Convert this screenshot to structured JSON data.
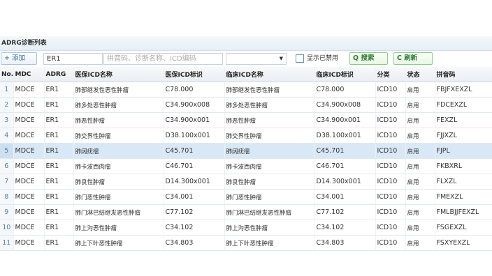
{
  "panel": {
    "title": "ADRG诊断列表"
  },
  "toolbar": {
    "add_label": "+ 添加",
    "code_value": "ER1",
    "search_placeholder": "拼音码、诊断名称、ICD编码",
    "dropdown_value": "",
    "show_disabled_label": "显示已禁用",
    "search_label": "Q 搜索",
    "refresh_label": "C 刷新"
  },
  "table": {
    "columns": [
      "No.",
      "MDC",
      "ADRG",
      "医保ICD名称",
      "医保ICD标识",
      "临床ICD名称",
      "临床ICD标识",
      "分类",
      "状态",
      "拼音码"
    ],
    "rows": [
      {
        "no": "1",
        "mdc": "MDCE",
        "adrg": "ER1",
        "yb_name": "肺部继发性恶性肿瘤",
        "yb_code": "C78.000",
        "lc_name": "肺部继发性恶性肿瘤",
        "lc_code": "C78.000",
        "cls": "ICD10",
        "status": "启用",
        "py": "FBJFXEXZL"
      },
      {
        "no": "2",
        "mdc": "MDCE",
        "adrg": "ER1",
        "yb_name": "肺多处恶性肿瘤",
        "yb_code": "C34.900x008",
        "lc_name": "肺多处恶性肿瘤",
        "lc_code": "C34.900x008",
        "cls": "ICD10",
        "status": "启用",
        "py": "FDCEXZL"
      },
      {
        "no": "3",
        "mdc": "MDCE",
        "adrg": "ER1",
        "yb_name": "肺恶性肿瘤",
        "yb_code": "C34.900x001",
        "lc_name": "肺恶性肿瘤",
        "lc_code": "C34.900x001",
        "cls": "ICD10",
        "status": "启用",
        "py": "FEXZL"
      },
      {
        "no": "4",
        "mdc": "MDCE",
        "adrg": "ER1",
        "yb_name": "肺交界性肿瘤",
        "yb_code": "D38.100x001",
        "lc_name": "肺交界性肿瘤",
        "lc_code": "D38.100x001",
        "cls": "ICD10",
        "status": "启用",
        "py": "FJJXZL"
      },
      {
        "no": "5",
        "mdc": "MDCE",
        "adrg": "ER1",
        "yb_name": "肺阔疣瘤",
        "yb_code": "C45.701",
        "lc_name": "肺阔疣瘤",
        "lc_code": "C45.701",
        "cls": "ICD10",
        "status": "启用",
        "py": "FJPL"
      },
      {
        "no": "6",
        "mdc": "MDCE",
        "adrg": "ER1",
        "yb_name": "肺卡波西肉瘤",
        "yb_code": "C46.701",
        "lc_name": "肺卡波西肉瘤",
        "lc_code": "C46.701",
        "cls": "ICD10",
        "status": "启用",
        "py": "FKBXRL"
      },
      {
        "no": "7",
        "mdc": "MDCE",
        "adrg": "ER1",
        "yb_name": "肺良性肿瘤",
        "yb_code": "D14.300x001",
        "lc_name": "肺良性肿瘤",
        "lc_code": "D14.300x001",
        "cls": "ICD10",
        "status": "启用",
        "py": "FLXZL"
      },
      {
        "no": "8",
        "mdc": "MDCE",
        "adrg": "ER1",
        "yb_name": "肺门恶性肿瘤",
        "yb_code": "C34.001",
        "lc_name": "肺门恶性肿瘤",
        "lc_code": "C34.001",
        "cls": "ICD10",
        "status": "启用",
        "py": "FMEXZL"
      },
      {
        "no": "9",
        "mdc": "MDCE",
        "adrg": "ER1",
        "yb_name": "肺门淋巴结继发恶性肿瘤",
        "yb_code": "C77.102",
        "lc_name": "肺门淋巴结继发恶性肿瘤",
        "lc_code": "C77.102",
        "cls": "ICD10",
        "status": "启用",
        "py": "FMLBJJFEXZL"
      },
      {
        "no": "10",
        "mdc": "MDCE",
        "adrg": "ER1",
        "yb_name": "肺上沟恶性肿瘤",
        "yb_code": "C34.102",
        "lc_name": "肺上沟恶性肿瘤",
        "lc_code": "C34.102",
        "cls": "ICD10",
        "status": "启用",
        "py": "FSGEXZL"
      },
      {
        "no": "11",
        "mdc": "MDCE",
        "adrg": "ER1",
        "yb_name": "肺上下叶恶性肿瘤",
        "yb_code": "C34.803",
        "lc_name": "肺上下叶恶性肿瘤",
        "lc_code": "C34.803",
        "cls": "ICD10",
        "status": "启用",
        "py": "FSXYEXZL"
      }
    ]
  }
}
